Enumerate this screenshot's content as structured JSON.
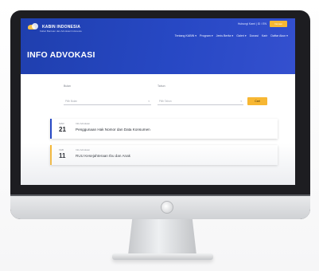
{
  "site": {
    "brand_name": "KABIN INDONESIA",
    "tagline": "Kabar Bantuan dan Advokasi Indonesia"
  },
  "topbar": {
    "text": "Hubungi Kami  |  ID / EN",
    "cta_label": "Donasi"
  },
  "nav": {
    "items": [
      {
        "label": "Tentang KABIN ▾"
      },
      {
        "label": "Program ▾"
      },
      {
        "label": "Jenis Berita ▾"
      },
      {
        "label": "Galeri ▾"
      },
      {
        "label": "Donasi"
      },
      {
        "label": "Karir"
      },
      {
        "label": "Daftar Akun ▾"
      }
    ]
  },
  "page": {
    "title": "INFO ADVOKASI"
  },
  "filters": {
    "month_label": "Bulan",
    "month_value": "Pilih Bulan",
    "year_label": "Tahun",
    "year_value": "Pilih Tahun",
    "search_label": "Cari"
  },
  "items": [
    {
      "month": "MAR",
      "day": "21",
      "category": "Info Advokasi",
      "title": "Penggunaan Hak Nomor dan Data Konsumen",
      "accent_color": "#2748c4"
    },
    {
      "month": "FEB",
      "day": "11",
      "category": "Info Advokasi",
      "title": "RUU Kesejahteraan Ibu dan Anak",
      "accent_color": "#f7b733"
    }
  ],
  "colors": {
    "header_blue": "#2748c4",
    "accent_yellow": "#f7b733"
  }
}
